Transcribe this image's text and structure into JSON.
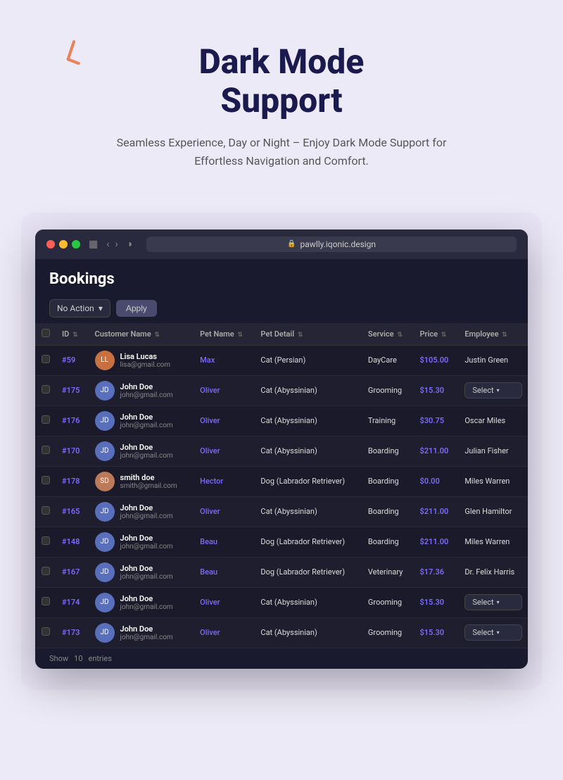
{
  "hero": {
    "title_line1": "Dark Mode",
    "title_line2": "Support",
    "subtitle": "Seamless Experience, Day or Night – Enjoy Dark Mode Support for Effortless Navigation and Comfort."
  },
  "browser": {
    "url": "pawlly.iqonic.design",
    "dots": [
      "red",
      "yellow",
      "green"
    ]
  },
  "bookings": {
    "title": "Bookings",
    "action_label": "No Action",
    "apply_label": "Apply",
    "columns": [
      "",
      "ID",
      "Customer Name",
      "Pet Name",
      "Pet Detail",
      "Service",
      "Price",
      "Employee"
    ],
    "rows": [
      {
        "id": "#59",
        "customer_name": "Lisa Lucas",
        "customer_email": "lisa@gmail.com",
        "pet_name": "Max",
        "pet_detail": "Cat (Persian)",
        "service": "DayCare",
        "price": "$105.00",
        "employee": "Justin Green",
        "has_select": false
      },
      {
        "id": "#175",
        "customer_name": "John Doe",
        "customer_email": "john@gmail.com",
        "pet_name": "Oliver",
        "pet_detail": "Cat (Abyssinian)",
        "service": "Grooming",
        "price": "$15.30",
        "employee": "Select",
        "has_select": true
      },
      {
        "id": "#176",
        "customer_name": "John Doe",
        "customer_email": "john@gmail.com",
        "pet_name": "Oliver",
        "pet_detail": "Cat (Abyssinian)",
        "service": "Training",
        "price": "$30.75",
        "employee": "Oscar Miles",
        "has_select": false
      },
      {
        "id": "#170",
        "customer_name": "John Doe",
        "customer_email": "john@gmail.com",
        "pet_name": "Oliver",
        "pet_detail": "Cat (Abyssinian)",
        "service": "Boarding",
        "price": "$211.00",
        "employee": "Julian Fisher",
        "has_select": false
      },
      {
        "id": "#178",
        "customer_name": "smith doe",
        "customer_email": "smith@gmail.com",
        "pet_name": "Hector",
        "pet_detail": "Dog (Labrador Retriever)",
        "service": "Boarding",
        "price": "$0.00",
        "employee": "Miles Warren",
        "has_select": false
      },
      {
        "id": "#165",
        "customer_name": "John Doe",
        "customer_email": "john@gmail.com",
        "pet_name": "Oliver",
        "pet_detail": "Cat (Abyssinian)",
        "service": "Boarding",
        "price": "$211.00",
        "employee": "Glen Hamiltor",
        "has_select": false
      },
      {
        "id": "#148",
        "customer_name": "John Doe",
        "customer_email": "john@gmail.com",
        "pet_name": "Beau",
        "pet_detail": "Dog (Labrador Retriever)",
        "service": "Boarding",
        "price": "$211.00",
        "employee": "Miles Warren",
        "has_select": false
      },
      {
        "id": "#167",
        "customer_name": "John Doe",
        "customer_email": "john@gmail.com",
        "pet_name": "Beau",
        "pet_detail": "Dog (Labrador Retriever)",
        "service": "Veterinary",
        "price": "$17.36",
        "employee": "Dr. Felix Harris",
        "has_select": false
      },
      {
        "id": "#174",
        "customer_name": "John Doe",
        "customer_email": "john@gmail.com",
        "pet_name": "Oliver",
        "pet_detail": "Cat (Abyssinian)",
        "service": "Grooming",
        "price": "$15.30",
        "employee": "Select",
        "has_select": true
      },
      {
        "id": "#173",
        "customer_name": "John Doe",
        "customer_email": "john@gmail.com",
        "pet_name": "Oliver",
        "pet_detail": "Cat (Abyssinian)",
        "service": "Grooming",
        "price": "$15.30",
        "employee": "Select",
        "has_select": true
      }
    ],
    "footer": {
      "show_label": "Show",
      "entries_label": "entries",
      "count": "10"
    }
  },
  "avatars": {
    "colors": [
      "#e8845c",
      "#6b8de8",
      "#6b8de8",
      "#6b8de8",
      "#e88c6b",
      "#6b8de8",
      "#6b8de8",
      "#6b8de8",
      "#6b8de8",
      "#6b8de8"
    ]
  }
}
